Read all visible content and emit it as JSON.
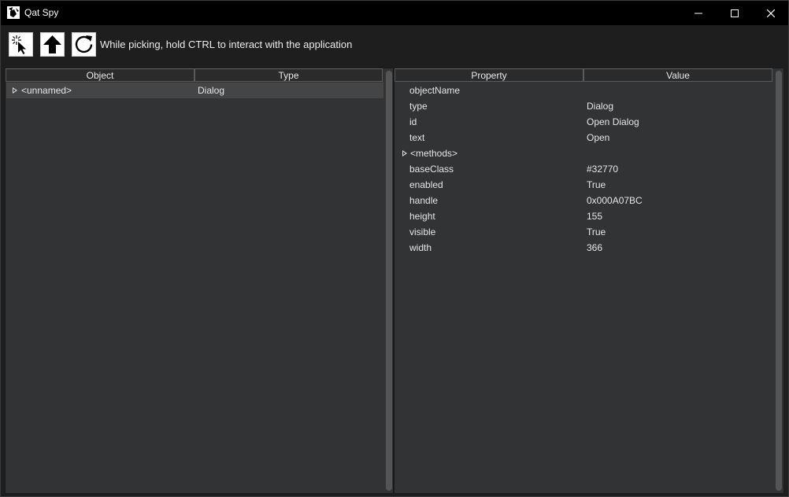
{
  "window": {
    "title": "Qat Spy"
  },
  "toolbar": {
    "hint": "While picking, hold CTRL to interact with the application"
  },
  "icons": {
    "app": "qat-spy-app-icon",
    "pick": "cursor-pick-icon",
    "up": "arrow-up-icon",
    "refresh": "refresh-icon",
    "minimize": "minimize-icon",
    "maximize": "maximize-icon",
    "close": "close-icon"
  },
  "object_tree": {
    "columns": [
      "Object",
      "Type"
    ],
    "rows": [
      {
        "object": "<unnamed>",
        "type": "Dialog",
        "expandable": true,
        "selected": true
      }
    ]
  },
  "properties": {
    "columns": [
      "Property",
      "Value"
    ],
    "rows": [
      {
        "property": "objectName",
        "value": ""
      },
      {
        "property": "type",
        "value": "Dialog"
      },
      {
        "property": "id",
        "value": "Open Dialog"
      },
      {
        "property": "text",
        "value": "Open"
      },
      {
        "property": "<methods>",
        "value": "",
        "expandable": true
      },
      {
        "property": "baseClass",
        "value": "#32770"
      },
      {
        "property": "enabled",
        "value": "True"
      },
      {
        "property": "handle",
        "value": "0x000A07BC"
      },
      {
        "property": "height",
        "value": "155"
      },
      {
        "property": "visible",
        "value": "True"
      },
      {
        "property": "width",
        "value": "366"
      }
    ]
  },
  "colors": {
    "panel_bg": "#313335",
    "window_bg": "#1e1e1e",
    "titlebar_bg": "#000000",
    "selection": "#454545"
  }
}
